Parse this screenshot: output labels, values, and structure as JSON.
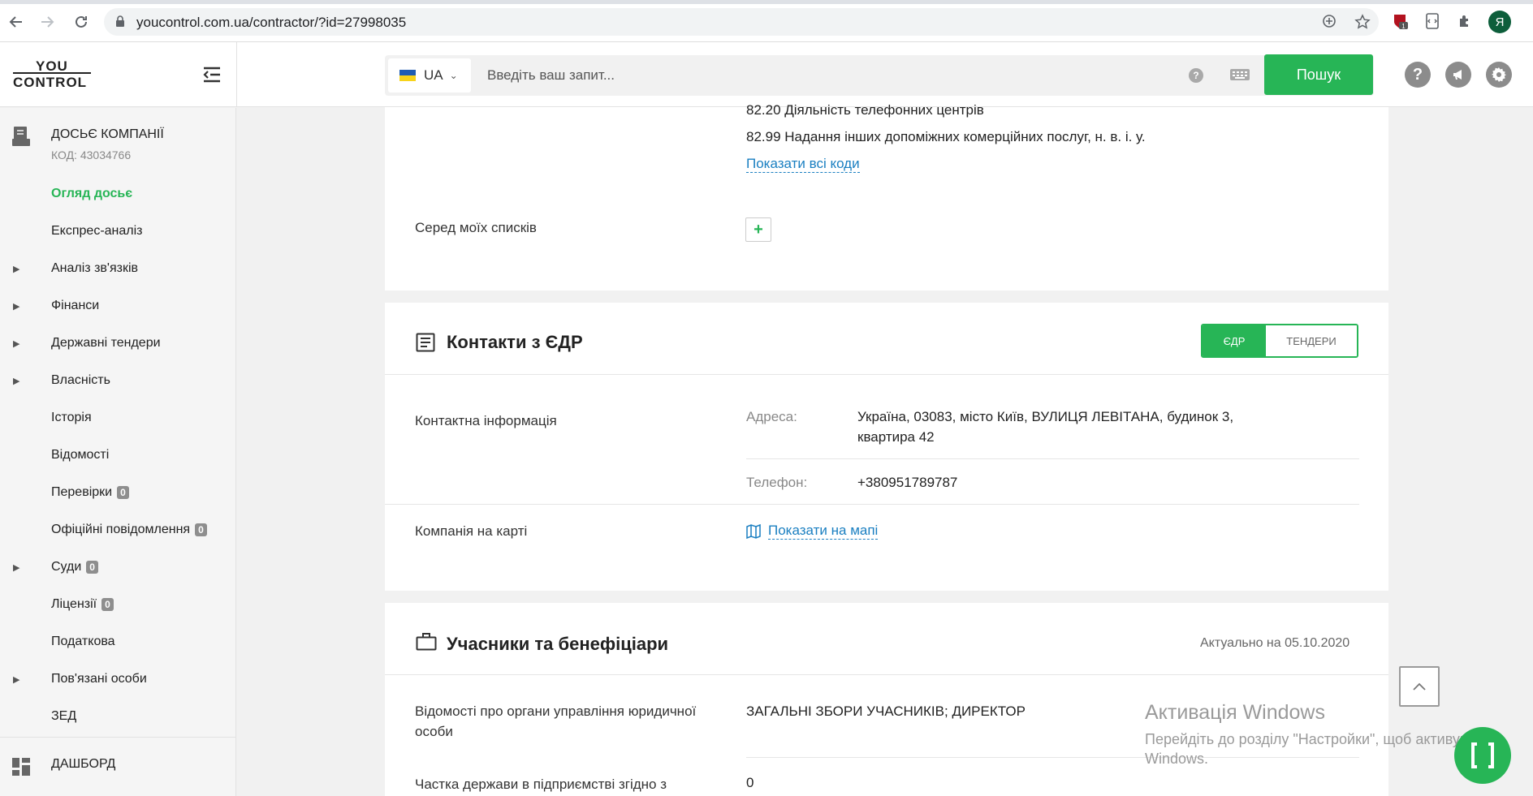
{
  "browser": {
    "url": "youcontrol.com.ua/contractor/?id=27998035",
    "extension_badge": "1",
    "avatar_letter": "Я"
  },
  "header": {
    "logo_top": "YOU",
    "logo_bottom": "CONTROL",
    "lang": "UA",
    "search_placeholder": "Введіть ваш запит...",
    "help_mark": "?",
    "search_button": "Пошук"
  },
  "sidebar": {
    "title": "ДОСЬЄ КОМПАНІЇ",
    "code": "КОД: 43034766",
    "items": [
      {
        "label": "Огляд досьє",
        "active": true,
        "arrow": false
      },
      {
        "label": "Експрес-аналіз",
        "arrow": false
      },
      {
        "label": "Аналіз зв'язків",
        "arrow": true
      },
      {
        "label": "Фінанси",
        "arrow": true
      },
      {
        "label": "Державні тендери",
        "arrow": true
      },
      {
        "label": "Власність",
        "arrow": true
      },
      {
        "label": "Історія",
        "arrow": false
      },
      {
        "label": "Відомості",
        "arrow": false
      },
      {
        "label": "Перевірки",
        "arrow": false,
        "badge": "0"
      },
      {
        "label": "Офіційні повідомлення",
        "arrow": false,
        "badge": "0"
      },
      {
        "label": "Суди",
        "arrow": true,
        "badge": "0"
      },
      {
        "label": "Ліцензії",
        "arrow": false,
        "badge": "0"
      },
      {
        "label": "Податкова",
        "arrow": false
      },
      {
        "label": "Пов'язані особи",
        "arrow": true
      },
      {
        "label": "ЗЕД",
        "arrow": false
      }
    ],
    "dashboard": "ДАШБОРД"
  },
  "card1": {
    "kved_1": "82.20 Діяльність телефонних центрів",
    "kved_2": "82.99 Надання інших допоміжних комерційних послуг, н. в. і. у.",
    "show_all_codes": "Показати всі коди",
    "lists_label": "Серед моїх списків",
    "add_symbol": "+"
  },
  "contacts": {
    "title": "Контакти з ЄДР",
    "toggle_edr": "ЄДР",
    "toggle_tenders": "ТЕНДЕРИ",
    "contact_info_label": "Контактна інформація",
    "address_label": "Адреса:",
    "address_line1": "Україна, 03083, місто Київ, ВУЛИЦЯ ЛЕВІТАНА, будинок 3,",
    "address_line2": "квартира 42",
    "phone_label": "Телефон:",
    "phone": "+380951789787",
    "map_label": "Компанія на карті",
    "map_link": "Показати на мапі"
  },
  "participants": {
    "title": "Учасники та бенефіціари",
    "actual": "Актуально на 05.10.2020",
    "row1_label_a": "Відомості про органи управління юридичної",
    "row1_label_b": "особи",
    "row1_value": "ЗАГАЛЬНІ ЗБОРИ УЧАСНИКІВ; ДИРЕКТОР",
    "row2_label": "Частка держави в підприємстві згідно з",
    "row2_value": "0"
  },
  "watermark": {
    "line1": "Активація Windows",
    "line2": "Перейдіть до розділу \"Настройки\", щоб активувати",
    "line3": "Windows."
  },
  "colors": {
    "brand_green": "#27b556",
    "link_blue": "#1a7fc1"
  }
}
